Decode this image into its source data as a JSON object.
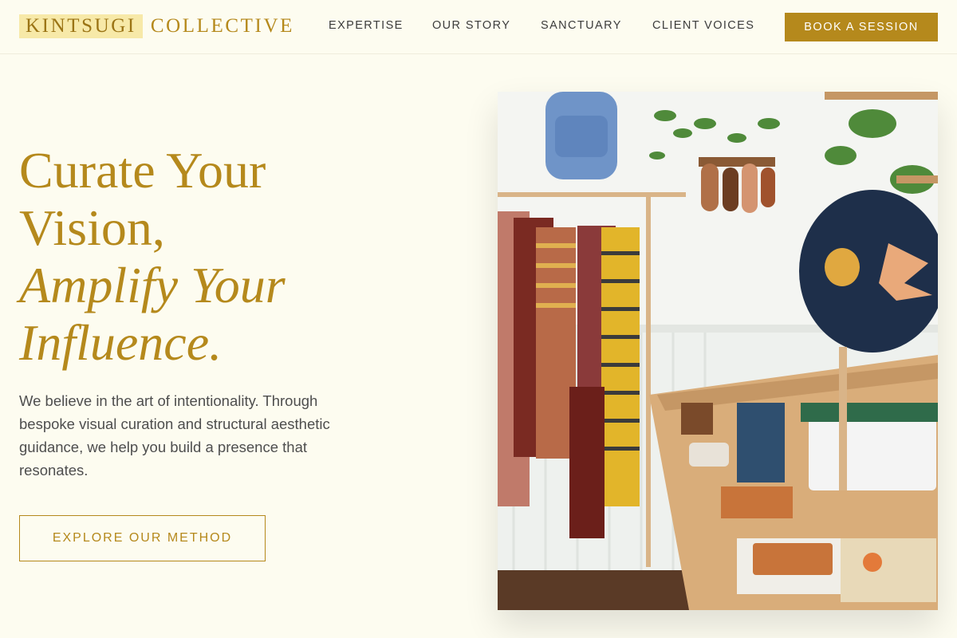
{
  "brand": {
    "logo_mark": "KINTSUGI",
    "logo_rest": "COLLECTIVE"
  },
  "nav": {
    "items": [
      {
        "label": "EXPERTISE"
      },
      {
        "label": "OUR STORY"
      },
      {
        "label": "SANCTUARY"
      },
      {
        "label": "CLIENT VOICES"
      }
    ],
    "cta": "BOOK A SESSION"
  },
  "hero": {
    "title_line1": "Curate Your",
    "title_line2": "Vision,",
    "title_line3": "Amplify Your",
    "title_line4": "Influence.",
    "body": "We believe in the art of intentionality. Through bespoke visual curation and structural aesthetic guidance, we help you build a presence that resonates.",
    "cta": "EXPLORE OUR METHOD"
  },
  "colors": {
    "background": "#fdfcf0",
    "accent_gold": "#b5891c",
    "logo_highlight": "#f7e9a8",
    "text": "#4e4e4e"
  }
}
